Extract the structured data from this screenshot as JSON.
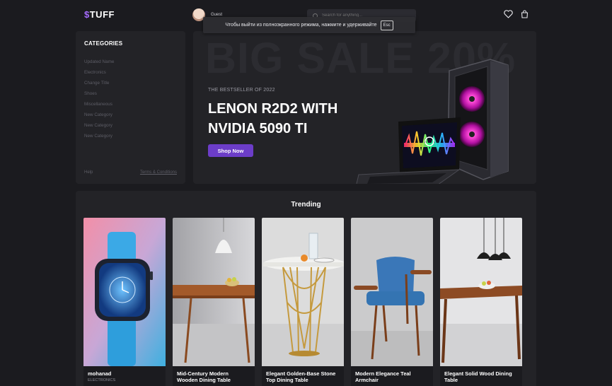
{
  "header": {
    "logo_prefix": "$",
    "logo_text": "TUFF",
    "user_name": "Guest",
    "search_placeholder": "Search for anything..."
  },
  "overlay": {
    "message": "Чтобы выйти из полноэкранного режима, нажмите и удерживайте",
    "key": "Esc"
  },
  "sidebar": {
    "title": "CATEGORIES",
    "items": [
      "Updated Name",
      "Electronics",
      "Change Title",
      "Shoes",
      "Miscellaneous",
      "New Category",
      "New Category",
      "New Category"
    ],
    "help": "Help",
    "terms": "Terms & Conditions"
  },
  "banner": {
    "bg_text": "BIG SALE 20%",
    "kicker": "THE BESTSELLER OF 2022",
    "title": "LENON R2D2 WITH NVIDIA 5090 TI",
    "cta": "Shop Now"
  },
  "trending": {
    "title": "Trending",
    "products": [
      {
        "name": "mohanad",
        "category": "ELECTRONICS"
      },
      {
        "name": "Mid-Century Modern Wooden Dining Table",
        "category": ""
      },
      {
        "name": "Elegant Golden-Base Stone Top Dining Table",
        "category": ""
      },
      {
        "name": "Modern Elegance Teal Armchair",
        "category": ""
      },
      {
        "name": "Elegant Solid Wood Dining Table",
        "category": ""
      }
    ]
  },
  "colors": {
    "accent": "#6c3dc8",
    "background": "#1b1b1f",
    "panel": "#232327"
  }
}
